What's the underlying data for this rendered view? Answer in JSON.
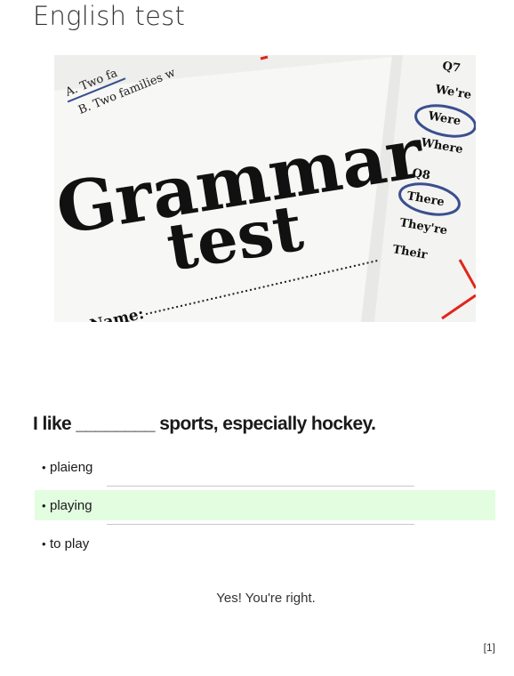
{
  "page": {
    "title": "English test"
  },
  "hero_image": {
    "heading_line1": "Grammar",
    "heading_line2": "test",
    "name_label": "Name:",
    "corner_top_left_1": "A. Two fa",
    "corner_top_left_2": "B. Two families w",
    "right_column": [
      "Q7",
      "We're",
      "Were",
      "Where",
      "Q8",
      "There",
      "They're",
      "Their"
    ],
    "accent_color": "#3a4f8f",
    "mark_color": "#e0261b"
  },
  "quiz": {
    "question": "I like ________ sports, especially hockey.",
    "options": [
      {
        "label": "plaieng",
        "state": "normal"
      },
      {
        "label": "playing",
        "state": "correct"
      },
      {
        "label": "to play",
        "state": "normal"
      }
    ],
    "bullet": "•",
    "correct_color": "#e2fde0",
    "feedback": "Yes! You're right."
  },
  "footnote": "[1]"
}
